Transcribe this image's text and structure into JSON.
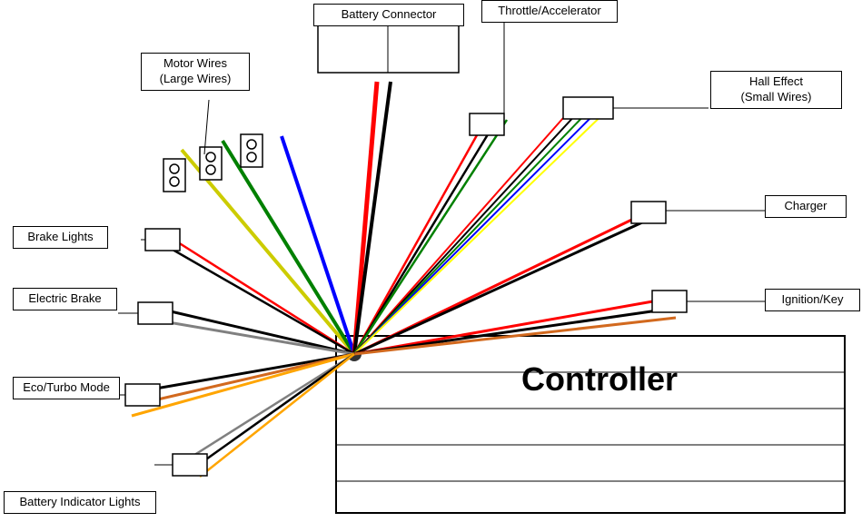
{
  "labels": {
    "battery_connector": "Battery Connector",
    "motor_wires": "Motor Wires\n(Large Wires)",
    "throttle": "Throttle/Accelerator",
    "hall_effect": "Hall Effect\n(Small Wires)",
    "charger": "Charger",
    "brake_lights": "Brake Lights",
    "electric_brake": "Electric Brake",
    "eco_turbo": "Eco/Turbo Mode",
    "ignition_key": "Ignition/Key",
    "battery_indicator": "Battery Indicator Lights",
    "controller": "Controller"
  }
}
